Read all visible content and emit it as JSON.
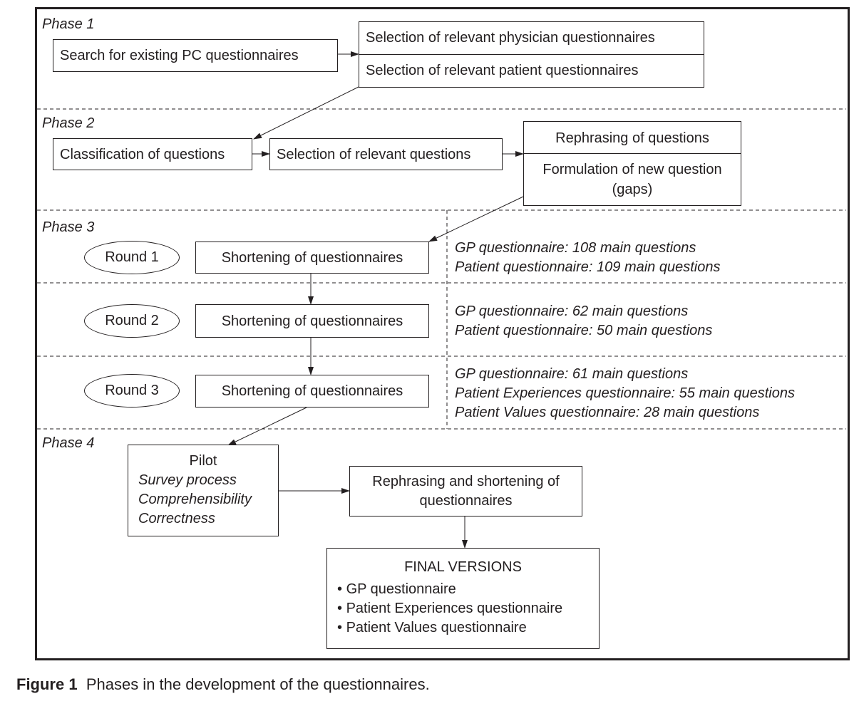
{
  "phases": [
    {
      "label": "Phase 1"
    },
    {
      "label": "Phase 2"
    },
    {
      "label": "Phase 3"
    },
    {
      "label": "Phase 4"
    }
  ],
  "phase1": {
    "search_box": "Search for existing PC questionnaires",
    "selection_physician": "Selection of relevant physician questionnaires",
    "selection_patient": "Selection of relevant patient questionnaires"
  },
  "phase2": {
    "classification": "Classification of questions",
    "selection_questions": "Selection of relevant questions",
    "rephrasing": "Rephrasing of questions",
    "formulation_line1": "Formulation of new question",
    "formulation_line2": "(gaps)"
  },
  "phase3": {
    "rounds": [
      {
        "label": "Round 1",
        "action": "Shortening of questionnaires",
        "notes": [
          "GP questionnaire: 108 main questions",
          "Patient questionnaire: 109 main questions"
        ]
      },
      {
        "label": "Round 2",
        "action": "Shortening of questionnaires",
        "notes": [
          "GP questionnaire: 62 main questions",
          "Patient questionnaire: 50 main questions"
        ]
      },
      {
        "label": "Round 3",
        "action": "Shortening of questionnaires",
        "notes": [
          "GP questionnaire: 61 main questions",
          "Patient Experiences questionnaire: 55 main questions",
          "Patient Values questionnaire: 28 main questions"
        ]
      }
    ]
  },
  "phase4": {
    "pilot_title": "Pilot",
    "pilot_items": [
      "Survey process",
      "Comprehensibility",
      "Correctness"
    ],
    "rephrasing_line1": "Rephrasing and shortening of",
    "rephrasing_line2": "questionnaires",
    "final_title": "FINAL VERSIONS",
    "final_items": [
      "GP questionnaire",
      "Patient Experiences questionnaire",
      "Patient Values questionnaire"
    ],
    "bullet": "•"
  },
  "caption": {
    "label": "Figure 1",
    "text": "Phases in the development of the questionnaires."
  }
}
